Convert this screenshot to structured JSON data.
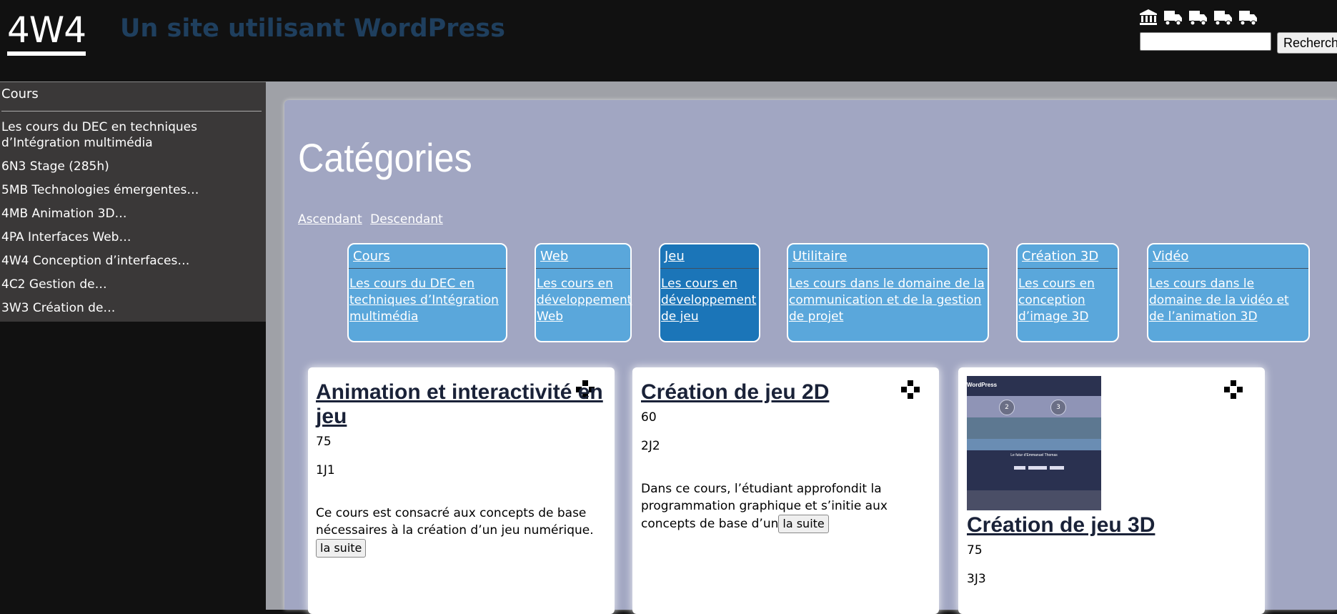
{
  "header": {
    "logo": "4W4",
    "site_title": "Un site utilisant WordPress",
    "icons": [
      "museum-icon",
      "truck-icon",
      "truck-icon",
      "truck-icon",
      "truck-icon"
    ],
    "search_placeholder": "",
    "search_button": "Recherch"
  },
  "sidebar": {
    "title": "Cours",
    "items": [
      "Les cours du DEC en techniques d’Intégration multimédia",
      "6N3 Stage (285h)",
      "5MB Technologies émergentes…",
      "4MB Animation 3D…",
      "4PA Interfaces Web…",
      "4W4 Conception d’interfaces…",
      "4C2 Gestion de…",
      "3W3 Création de…"
    ]
  },
  "main": {
    "heading": "Catégories",
    "sort_asc": "Ascendant",
    "sort_desc": "Descendant",
    "categories": [
      {
        "name": "Cours",
        "desc": "Les cours du DEC en techniques d’Intégration multimédia"
      },
      {
        "name": "Web",
        "desc": "Les cours en développement Web"
      },
      {
        "name": "Jeu",
        "desc": "Les cours en développement de jeu"
      },
      {
        "name": "Utilitaire",
        "desc": "Les cours dans le domaine de la communication et de la gestion de projet"
      },
      {
        "name": "Création 3D",
        "desc": "Les cours en conception d’image 3D"
      },
      {
        "name": "Vidéo",
        "desc": "Les cours dans le domaine de la vidéo et de l’animation 3D"
      }
    ],
    "cards": [
      {
        "title": "Animation et interactivité en jeu",
        "hours": "75",
        "code": "1J1",
        "desc": "Ce cours est consacré aux concepts de base nécessaires à la création d’un jeu numérique.",
        "more": "la suite"
      },
      {
        "title": "Création de jeu 2D",
        "hours": "60",
        "code": "2J2",
        "desc": "Dans ce cours, l’étudiant approfondit la programmation graphique et s’initie aux concepts de base d’un",
        "more": "la suite"
      },
      {
        "title": "Création de jeu 3D",
        "hours": "75",
        "code": "3J3",
        "thumb_label": "WordPress",
        "thumb_circles": [
          "2",
          "3"
        ],
        "thumb_caption": "Le futur d’Emmanuel Thomas"
      }
    ],
    "card_icon": "gamepad-icon"
  },
  "colors": {
    "background": "#111111",
    "site_title": "#1f3f5e",
    "sidebar": "#3a3838",
    "panel": "#a1a6c2",
    "category": "#5aa7db",
    "category_active": "#1b75b8",
    "card_title": "#1a2238"
  }
}
